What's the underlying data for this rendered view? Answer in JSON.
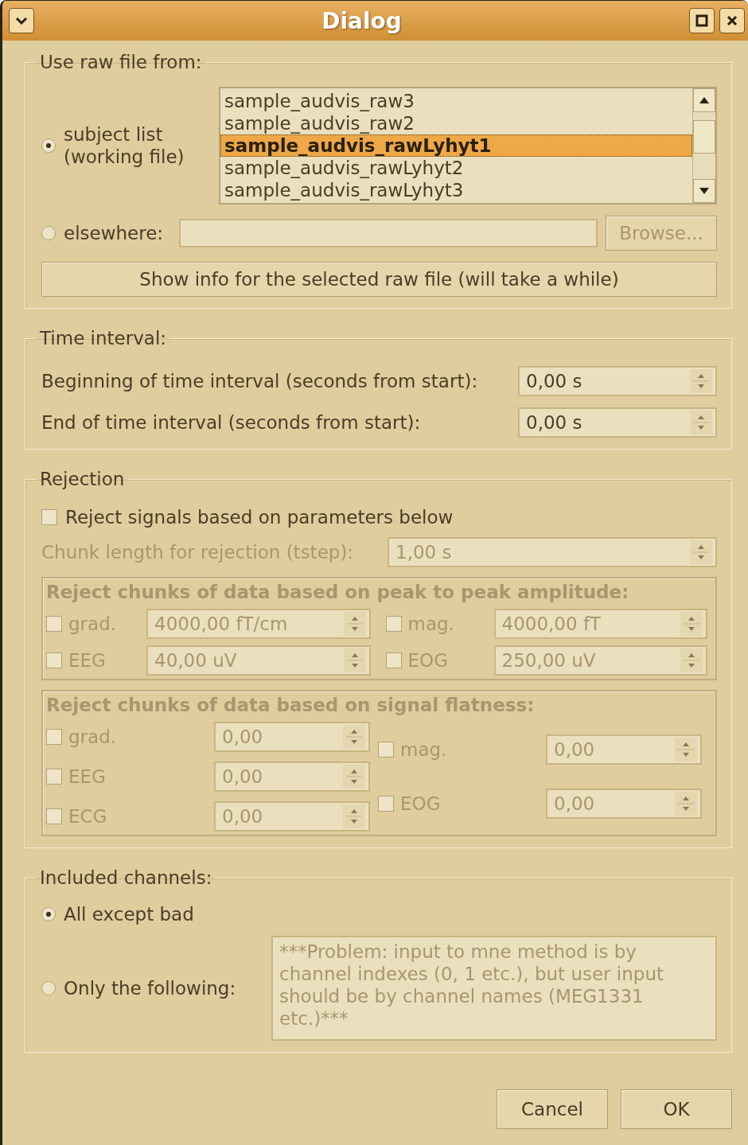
{
  "window": {
    "title": "Dialog"
  },
  "source": {
    "title": "Use raw file from:",
    "options": [
      {
        "label": "subject list\n(working file)",
        "selected": true
      },
      {
        "label": "elsewhere:",
        "selected": false
      }
    ],
    "files": [
      {
        "name": "sample_audvis_raw3",
        "selected": false
      },
      {
        "name": "sample_audvis_raw2",
        "selected": false
      },
      {
        "name": "sample_audvis_rawLyhyt1",
        "selected": true
      },
      {
        "name": "sample_audvis_rawLyhyt2",
        "selected": false
      },
      {
        "name": "sample_audvis_rawLyhyt3",
        "selected": false
      }
    ],
    "browse_button": {
      "label": "Browse...",
      "disabled": true
    },
    "info_button": {
      "label": "Show info for the selected raw file (will take a while)",
      "disabled": false
    }
  },
  "time": {
    "title": "Time interval:",
    "fields": [
      {
        "label": "Beginning of time interval (seconds from start):",
        "value": "0,00 s"
      },
      {
        "label": "End of time interval (seconds from start):",
        "value": "0,00 s"
      }
    ]
  },
  "rejection": {
    "title": "Rejection",
    "enable": {
      "label": "Reject signals based on parameters below",
      "checked": false
    },
    "chunk": {
      "label": "Chunk length for rejection (tstep):",
      "value": "1,00 s",
      "disabled": true
    },
    "groups": [
      {
        "kind": "grid",
        "title": "Reject chunks of data based on peak to peak amplitude:",
        "disabled": true,
        "left": [
          {
            "label": "grad.",
            "checked": false,
            "value": "4000,00 fT/cm"
          },
          {
            "label": "EEG",
            "checked": false,
            "value": "40,00 uV"
          }
        ],
        "right": [
          {
            "label": "mag.",
            "checked": false,
            "value": "4000,00 fT"
          },
          {
            "label": "EOG",
            "checked": false,
            "value": "250,00 uV"
          }
        ]
      },
      {
        "kind": "columns",
        "title": "Reject chunks of data based on signal flatness:",
        "disabled": true,
        "left": [
          {
            "label": "grad.",
            "checked": false,
            "value": "0,00"
          },
          {
            "label": "EEG",
            "checked": false,
            "value": "0,00"
          },
          {
            "label": "ECG",
            "checked": false,
            "value": "0,00"
          }
        ],
        "right": [
          {
            "label": "mag.",
            "checked": false,
            "value": "0,00"
          },
          {
            "label": "EOG",
            "checked": false,
            "value": "0,00"
          }
        ]
      }
    ]
  },
  "channels": {
    "title": "Included channels:",
    "options": [
      {
        "label": "All except bad",
        "selected": true
      },
      {
        "label": "Only the following:",
        "selected": false
      }
    ],
    "list": {
      "placeholder": "***Problem: input to mne method is by channel indexes (0, 1 etc.), but user input should be by channel names (MEG1331 etc.)***"
    }
  },
  "buttons": [
    {
      "label": "Cancel"
    },
    {
      "label": "OK"
    }
  ]
}
